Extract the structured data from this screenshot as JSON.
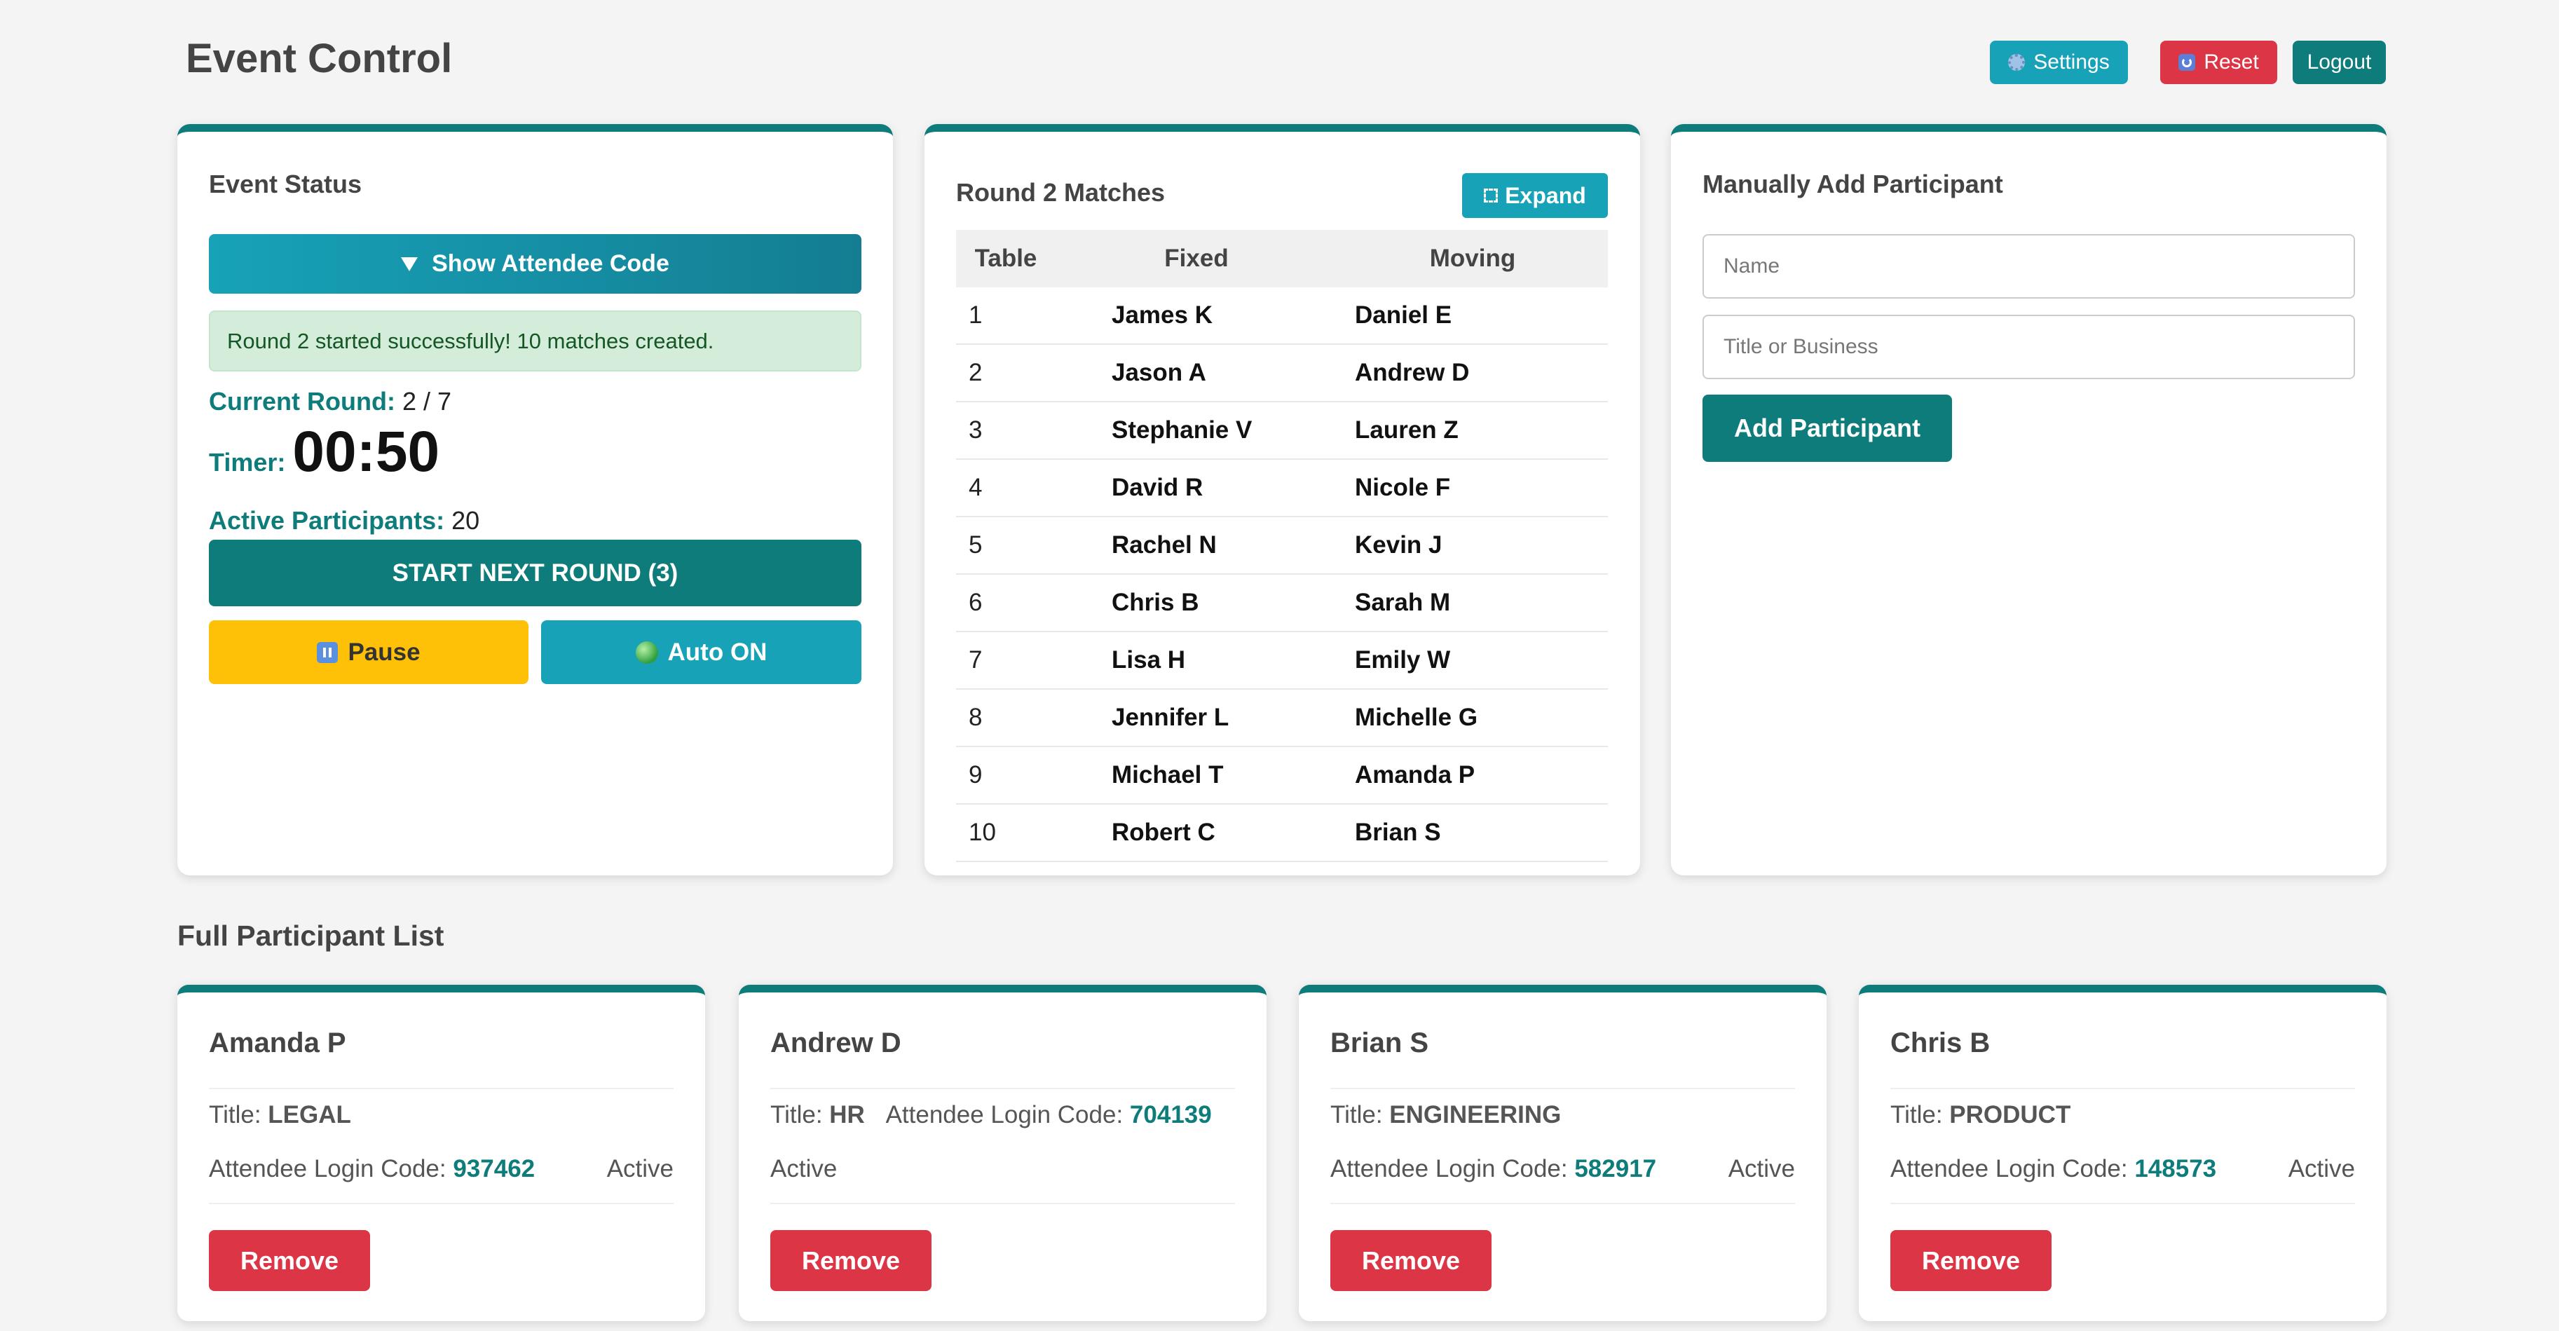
{
  "header": {
    "title": "Event Control",
    "settings_label": "Settings",
    "reset_label": "Reset",
    "logout_label": "Logout"
  },
  "event_status": {
    "heading": "Event Status",
    "show_code_label": "Show Attendee Code",
    "alert_text": "Round 2 started successfully! 10 matches created.",
    "current_round_label": "Current Round:",
    "current_round_value": "2 / 7",
    "timer_label": "Timer:",
    "timer_value": "00:50",
    "active_label": "Active Participants:",
    "active_value": "20",
    "next_round_label": "START NEXT ROUND (3)",
    "pause_label": "Pause",
    "auto_label": "Auto ON"
  },
  "matches": {
    "heading": "Round 2 Matches",
    "expand_label": "Expand",
    "columns": [
      "Table",
      "Fixed",
      "Moving"
    ],
    "rows": [
      [
        "1",
        "James K",
        "Daniel E"
      ],
      [
        "2",
        "Jason A",
        "Andrew D"
      ],
      [
        "3",
        "Stephanie V",
        "Lauren Z"
      ],
      [
        "4",
        "David R",
        "Nicole F"
      ],
      [
        "5",
        "Rachel N",
        "Kevin J"
      ],
      [
        "6",
        "Chris B",
        "Sarah M"
      ],
      [
        "7",
        "Lisa H",
        "Emily W"
      ],
      [
        "8",
        "Jennifer L",
        "Michelle G"
      ],
      [
        "9",
        "Michael T",
        "Amanda P"
      ],
      [
        "10",
        "Robert C",
        "Brian S"
      ]
    ]
  },
  "add_participant": {
    "heading": "Manually Add Participant",
    "name_placeholder": "Name",
    "name_value": "",
    "title_placeholder": "Title or Business",
    "title_value": "",
    "button_label": "Add Participant"
  },
  "participants": {
    "heading": "Full Participant List",
    "title_label": "Title:",
    "code_label": "Attendee Login Code:",
    "remove_label": "Remove",
    "items": [
      {
        "name": "Amanda P",
        "title": "LEGAL",
        "code": "937462",
        "status": "Active"
      },
      {
        "name": "Andrew D",
        "title": "HR",
        "code": "704139",
        "status": "Active"
      },
      {
        "name": "Brian S",
        "title": "ENGINEERING",
        "code": "582917",
        "status": "Active"
      },
      {
        "name": "Chris B",
        "title": "PRODUCT",
        "code": "148573",
        "status": "Active"
      }
    ]
  },
  "colors": {
    "primary": "#0e7c7b",
    "info": "#17a2b8",
    "danger": "#dc3545",
    "warning": "#ffc107",
    "success_bg": "#d4edda"
  }
}
